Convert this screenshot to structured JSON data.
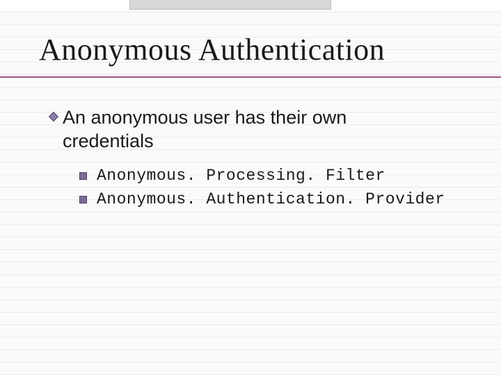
{
  "title": "Anonymous Authentication",
  "level1": {
    "line1": "An anonymous user has their own",
    "line2": "credentials"
  },
  "level2": {
    "item1": "Anonymous. Processing. Filter",
    "item2": "Anonymous. Authentication. Provider"
  }
}
